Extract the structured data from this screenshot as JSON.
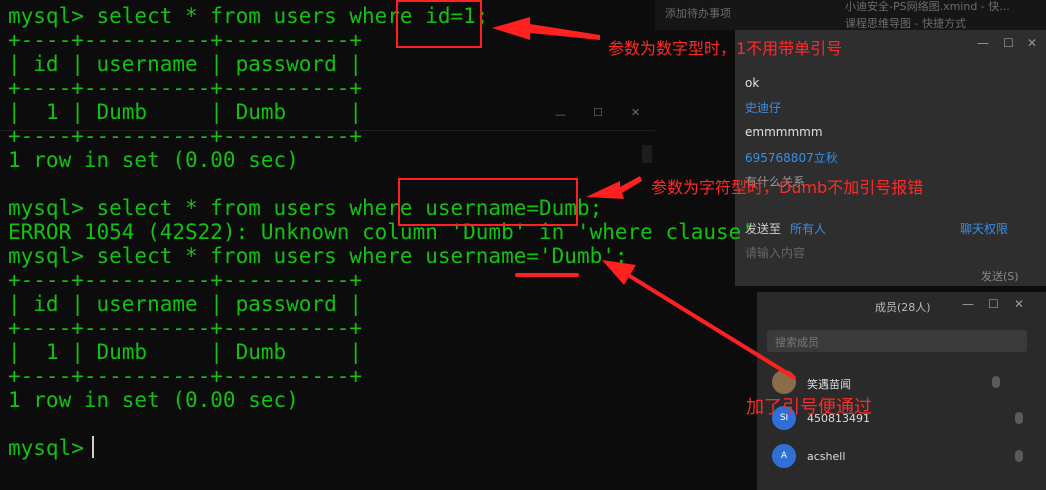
{
  "terminal": {
    "lines": [
      "mysql> select * from users where id=1;",
      "+----+----------+----------+",
      "| id | username | password |",
      "+----+----------+----------+",
      "|  1 | Dumb     | Dumb     |",
      "+----+----------+----------+",
      "1 row in set (0.00 sec)",
      "",
      "mysql> select * from users where username=Dumb;",
      "ERROR 1054 (42S22): Unknown column 'Dumb' in 'where clause'",
      "mysql> select * from users where username='Dumb';",
      "+----+----------+----------+",
      "| id | username | password |",
      "+----+----------+----------+",
      "|  1 | Dumb     | Dumb     |",
      "+----+----------+----------+",
      "1 row in set (0.00 sec)",
      "",
      "mysql> "
    ]
  },
  "annotations": {
    "numeric_note": "参数为数字型时，1不用带单引号",
    "string_error_note": "参数为字符型时，Dumb不加引号报错",
    "quoted_note": "加了引号便通过"
  },
  "background": {
    "top_strip": {
      "todo": "添加待办事项",
      "file_title": "小迪安全-PS网络图.xmind - 快...",
      "course_title": "课程思维导图 - 快捷方式"
    },
    "chat": {
      "messages": [
        "ok",
        "史迪仔",
        "emmmmmm",
        "695768807立秋",
        "有什么关系"
      ],
      "send_to_label": "发送至",
      "send_to_value": "所有人",
      "chat_permission": "聊天权限",
      "input_placeholder": "请输入内容",
      "send_button": "发送(S)"
    },
    "members": {
      "title": "成员(28人)",
      "search_placeholder": "搜索成员",
      "list": [
        {
          "name": "笑遇苗闻"
        },
        {
          "name": "450813491",
          "initial": "SI"
        },
        {
          "name": "acshell",
          "initial": "A"
        }
      ]
    }
  },
  "colors": {
    "terminal_text": "#13c113",
    "annotation_red": "#ff2a2a",
    "link_blue": "#3a8ee6"
  }
}
